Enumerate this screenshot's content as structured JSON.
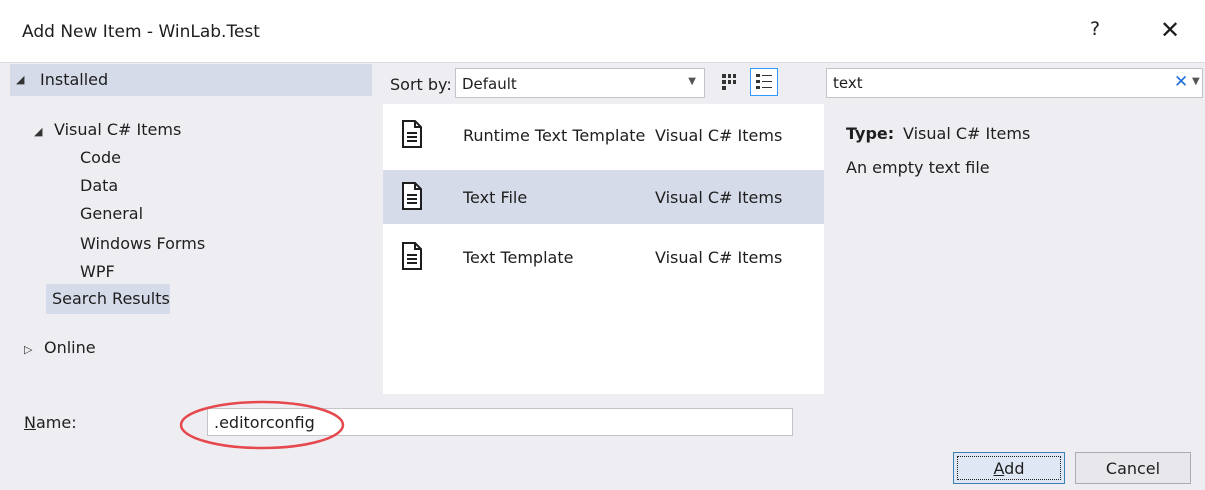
{
  "window": {
    "title": "Add New Item - WinLab.Test",
    "help_glyph": "?",
    "close_glyph": "✕"
  },
  "tree": {
    "installed": "Installed",
    "visual_csharp_items": "Visual C# Items",
    "children": [
      "Code",
      "Data",
      "General",
      "Windows Forms",
      "WPF"
    ],
    "search_results": "Search Results",
    "online": "Online"
  },
  "toolbar": {
    "sort_label": "Sort by:",
    "sort_value": "Default",
    "grid_view_icon": "small-icons-view-icon",
    "list_view_icon": "list-view-icon"
  },
  "search": {
    "value": "text"
  },
  "templates": [
    {
      "name": "Runtime Text Template",
      "category": "Visual C# Items",
      "selected": false
    },
    {
      "name": "Text File",
      "category": "Visual C# Items",
      "selected": true
    },
    {
      "name": "Text Template",
      "category": "Visual C# Items",
      "selected": false
    }
  ],
  "details": {
    "type_label": "Type:",
    "type_value": "Visual C# Items",
    "description": "An empty text file"
  },
  "footer": {
    "name_label_first": "N",
    "name_label_rest": "ame:",
    "name_value": ".editorconfig",
    "add_first": "A",
    "add_rest": "dd",
    "cancel": "Cancel"
  },
  "colors": {
    "selection": "#d6dbe9",
    "dialog_bg": "#eeeef2",
    "annotation": "#e5484d",
    "accent": "#3399ff"
  }
}
